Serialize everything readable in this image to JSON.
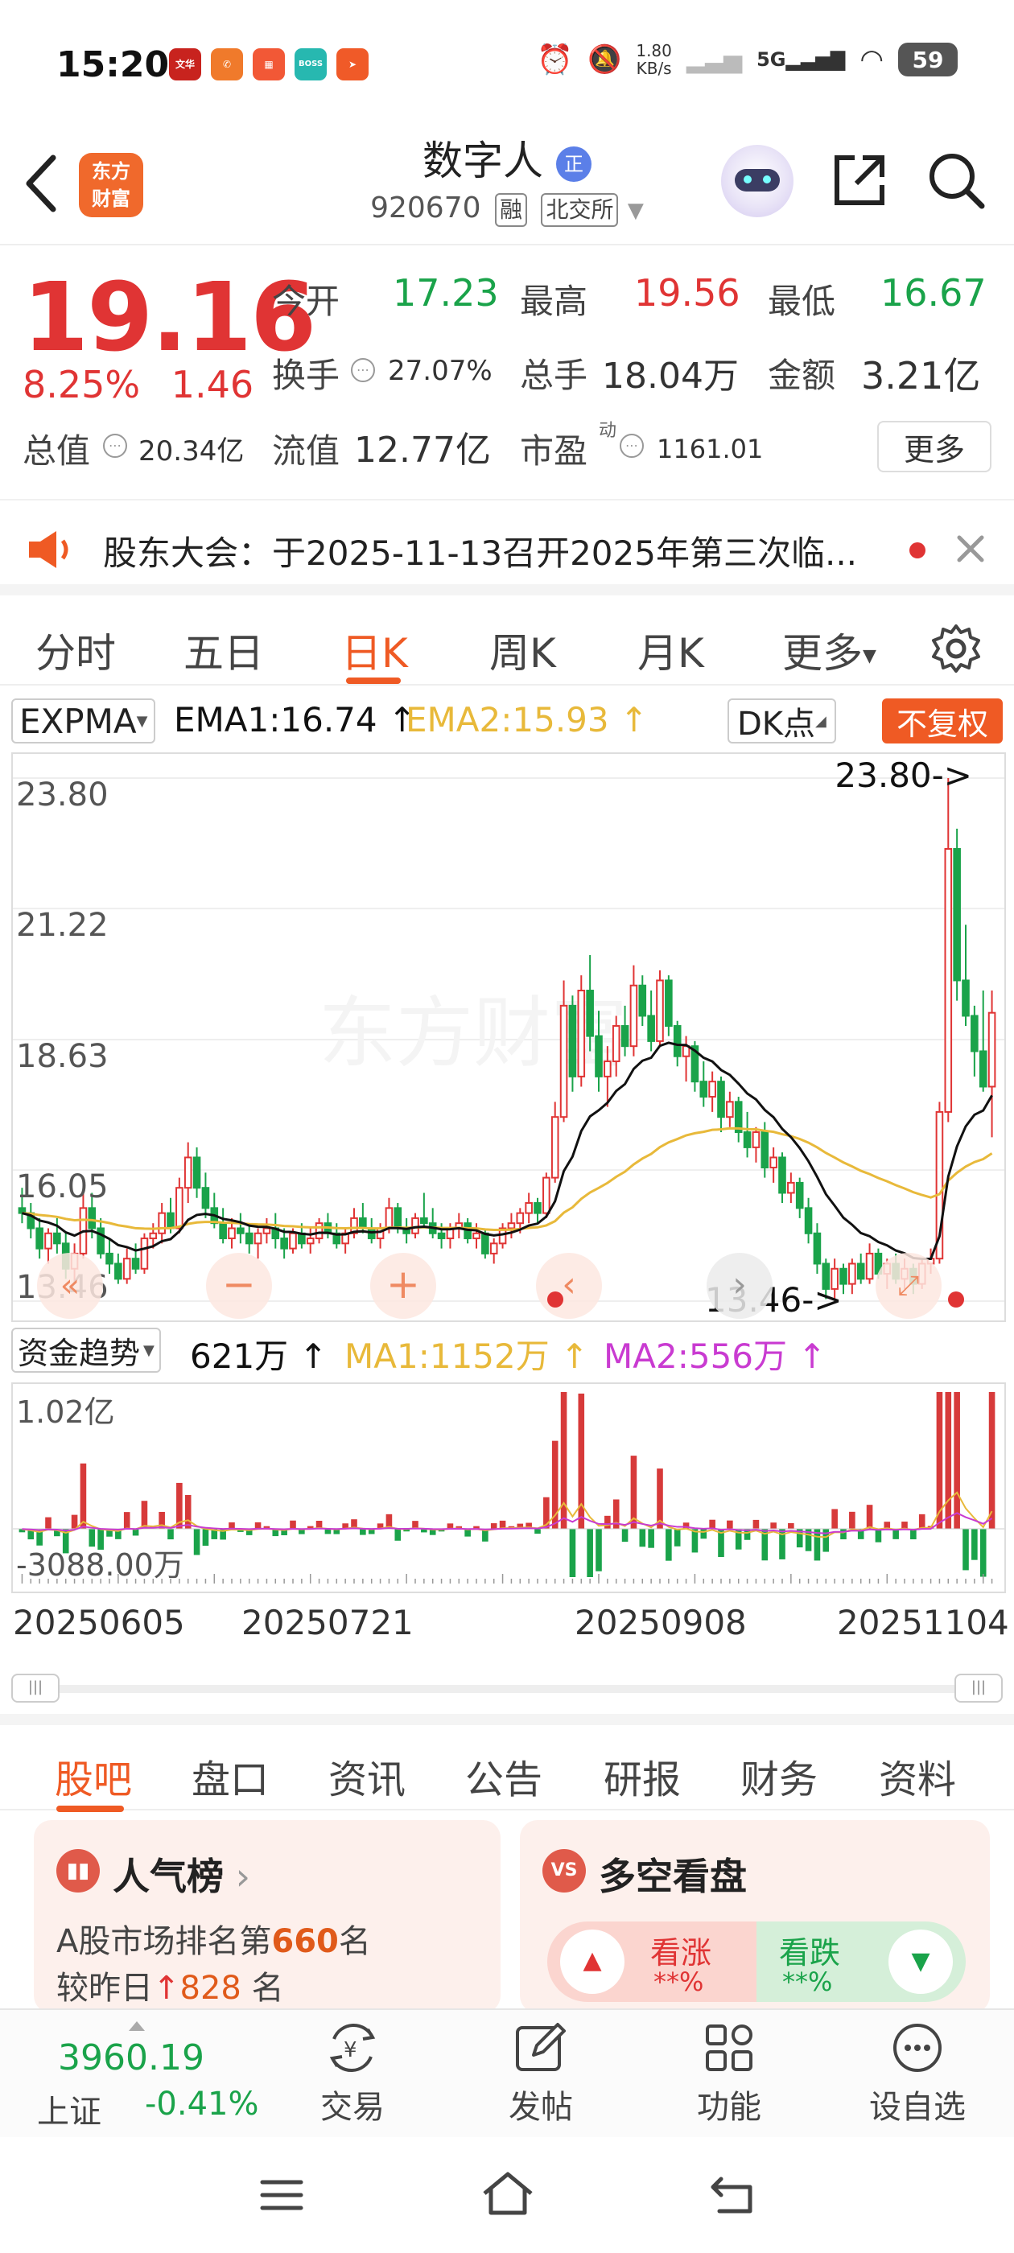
{
  "status": {
    "time": "15:20",
    "apps": [
      {
        "icon": "wenhua-app-icon",
        "text": "文华",
        "color": "#c8231e"
      },
      {
        "icon": "phone-app-icon",
        "text": "✆",
        "color": "#f07a2b"
      },
      {
        "icon": "app-icon-3",
        "text": "▦",
        "color": "#f25836"
      },
      {
        "icon": "boss-zhipin-icon",
        "text": "BOSS",
        "color": "#27b8b0"
      },
      {
        "icon": "send-app-icon",
        "text": "➤",
        "color": "#f05a28"
      }
    ],
    "net_speed": "1.80\nKB/s",
    "signal": "5G",
    "battery": "59"
  },
  "header": {
    "logo_line1": "东方",
    "logo_line2": "财富",
    "stock_name": "数字人",
    "stock_code": "920670",
    "tag_margin": "融",
    "tag_exchange": "北交所"
  },
  "quote": {
    "price": "19.16",
    "change_pct": "8.25%",
    "change": "1.46",
    "open_label": "今开",
    "open": "17.23",
    "high_label": "最高",
    "high": "19.56",
    "low_label": "最低",
    "low": "16.67",
    "turnover_label": "换手",
    "turnover": "27.07%",
    "volume_label": "总手",
    "volume": "18.04万",
    "amount_label": "金额",
    "amount": "3.21亿",
    "mktcap_label": "总值",
    "mktcap": "20.34亿",
    "float_label": "流值",
    "float": "12.77亿",
    "pe_label": "市盈",
    "pe_sup": "动",
    "pe": "1161.01",
    "more": "更多"
  },
  "notice": {
    "text": "股东大会：于2025-11-13召开2025年第三次临..."
  },
  "kline_tabs": [
    "分时",
    "五日",
    "日K",
    "周K",
    "月K",
    "更多"
  ],
  "active_kline_tab": 2,
  "indicator": {
    "name": "EXPMA",
    "ema1": "EMA1:16.74 ↑",
    "ema2": "EMA2:15.93 ↑",
    "dk": "DK点",
    "adjust": "不复权"
  },
  "chart_labels": {
    "y_ticks": [
      "23.80",
      "21.22",
      "18.63",
      "16.05",
      "13.46"
    ],
    "max_marker": "23.80->",
    "min_marker": "13.46->",
    "watermark": "东方财富"
  },
  "chart_data": [
    {
      "type": "candlestick",
      "ylim": [
        13.46,
        23.8
      ],
      "y_ticks": [
        23.8,
        21.22,
        18.63,
        16.05,
        13.46
      ],
      "x_ticks": [
        "20250605",
        "20250721",
        "20250908",
        "20251104"
      ],
      "max": 23.8,
      "min": 13.46,
      "series": [
        {
          "name": "EMA1",
          "last": 16.74,
          "color": "#111111"
        },
        {
          "name": "EMA2",
          "last": 15.93,
          "color": "#e8b93a"
        }
      ],
      "ohlc": [
        [
          15.3,
          15.7,
          15.0,
          15.2
        ],
        [
          15.2,
          15.4,
          14.7,
          14.9
        ],
        [
          14.9,
          15.1,
          14.3,
          14.5
        ],
        [
          14.5,
          14.9,
          14.2,
          14.8
        ],
        [
          14.8,
          15.1,
          14.4,
          14.6
        ],
        [
          14.6,
          14.8,
          13.9,
          14.1
        ],
        [
          14.1,
          14.6,
          13.8,
          14.4
        ],
        [
          14.4,
          15.6,
          14.3,
          15.3
        ],
        [
          15.3,
          15.6,
          14.7,
          14.9
        ],
        [
          14.9,
          15.1,
          14.3,
          14.4
        ],
        [
          14.4,
          14.7,
          14.0,
          14.2
        ],
        [
          14.2,
          14.4,
          13.8,
          13.9
        ],
        [
          13.9,
          14.5,
          13.8,
          14.3
        ],
        [
          14.3,
          14.6,
          14.0,
          14.1
        ],
        [
          14.1,
          14.8,
          14.0,
          14.7
        ],
        [
          14.7,
          15.0,
          14.5,
          14.8
        ],
        [
          14.8,
          15.4,
          14.6,
          15.2
        ],
        [
          15.2,
          15.5,
          14.8,
          14.9
        ],
        [
          14.9,
          15.9,
          14.8,
          15.7
        ],
        [
          15.7,
          16.6,
          15.4,
          16.3
        ],
        [
          16.3,
          16.5,
          15.5,
          15.7
        ],
        [
          15.7,
          16.0,
          15.1,
          15.3
        ],
        [
          15.3,
          15.6,
          14.9,
          15.0
        ],
        [
          15.0,
          15.3,
          14.6,
          14.7
        ],
        [
          14.7,
          15.1,
          14.5,
          14.9
        ],
        [
          14.9,
          15.2,
          14.6,
          14.8
        ],
        [
          14.8,
          15.0,
          14.4,
          14.6
        ],
        [
          14.6,
          14.9,
          14.3,
          14.8
        ],
        [
          14.8,
          15.1,
          14.6,
          14.9
        ],
        [
          14.9,
          15.2,
          14.5,
          14.7
        ],
        [
          14.7,
          14.9,
          14.3,
          14.5
        ],
        [
          14.5,
          14.9,
          14.4,
          14.8
        ],
        [
          14.8,
          15.0,
          14.5,
          14.6
        ],
        [
          14.6,
          14.9,
          14.4,
          14.7
        ],
        [
          14.7,
          15.1,
          14.6,
          15.0
        ],
        [
          15.0,
          15.2,
          14.7,
          14.8
        ],
        [
          14.8,
          15.0,
          14.5,
          14.6
        ],
        [
          14.6,
          14.9,
          14.4,
          14.8
        ],
        [
          14.8,
          15.3,
          14.7,
          15.1
        ],
        [
          15.1,
          15.4,
          14.8,
          14.9
        ],
        [
          14.9,
          15.1,
          14.6,
          14.7
        ],
        [
          14.7,
          15.0,
          14.5,
          14.9
        ],
        [
          14.9,
          15.5,
          14.8,
          15.3
        ],
        [
          15.3,
          15.4,
          14.8,
          14.9
        ],
        [
          14.9,
          15.1,
          14.6,
          14.8
        ],
        [
          14.8,
          15.2,
          14.7,
          15.1
        ],
        [
          15.1,
          15.6,
          14.9,
          15.0
        ],
        [
          15.0,
          15.3,
          14.7,
          14.8
        ],
        [
          14.8,
          15.0,
          14.5,
          14.7
        ],
        [
          14.7,
          15.0,
          14.5,
          14.9
        ],
        [
          14.9,
          15.2,
          14.7,
          15.0
        ],
        [
          15.0,
          15.1,
          14.6,
          14.7
        ],
        [
          14.7,
          15.0,
          14.5,
          14.8
        ],
        [
          14.8,
          14.9,
          14.3,
          14.4
        ],
        [
          14.4,
          14.7,
          14.2,
          14.6
        ],
        [
          14.6,
          15.0,
          14.5,
          14.9
        ],
        [
          14.9,
          15.2,
          14.7,
          15.0
        ],
        [
          15.0,
          15.3,
          14.8,
          15.2
        ],
        [
          15.2,
          15.6,
          15.0,
          15.4
        ],
        [
          15.4,
          15.5,
          15.0,
          15.2
        ],
        [
          15.2,
          16.0,
          15.1,
          15.9
        ],
        [
          15.9,
          17.4,
          15.8,
          17.1
        ],
        [
          17.1,
          19.8,
          17.0,
          19.3
        ],
        [
          19.3,
          19.5,
          17.6,
          17.9
        ],
        [
          17.9,
          19.9,
          17.7,
          19.6
        ],
        [
          19.6,
          20.3,
          18.4,
          18.7
        ],
        [
          18.7,
          19.2,
          17.6,
          17.9
        ],
        [
          17.9,
          18.5,
          17.3,
          18.2
        ],
        [
          18.2,
          19.1,
          17.9,
          18.9
        ],
        [
          18.9,
          19.3,
          18.3,
          18.5
        ],
        [
          18.5,
          20.1,
          18.3,
          19.7
        ],
        [
          19.7,
          19.9,
          18.9,
          19.1
        ],
        [
          19.1,
          19.6,
          18.4,
          18.6
        ],
        [
          18.6,
          20.0,
          18.5,
          19.8
        ],
        [
          19.8,
          19.9,
          18.7,
          18.9
        ],
        [
          18.9,
          19.0,
          18.1,
          18.3
        ],
        [
          18.3,
          18.7,
          17.8,
          18.5
        ],
        [
          18.5,
          18.6,
          17.6,
          17.8
        ],
        [
          17.8,
          18.2,
          17.3,
          17.5
        ],
        [
          17.5,
          18.0,
          17.2,
          17.8
        ],
        [
          17.8,
          17.9,
          16.8,
          17.1
        ],
        [
          17.1,
          17.6,
          16.9,
          17.4
        ],
        [
          17.4,
          17.5,
          16.6,
          16.8
        ],
        [
          16.8,
          17.2,
          16.3,
          16.5
        ],
        [
          16.5,
          16.9,
          16.2,
          16.8
        ],
        [
          16.8,
          17.0,
          15.9,
          16.1
        ],
        [
          16.1,
          16.5,
          15.8,
          16.3
        ],
        [
          16.3,
          16.4,
          15.4,
          15.6
        ],
        [
          15.6,
          16.0,
          15.4,
          15.8
        ],
        [
          15.8,
          15.9,
          15.1,
          15.3
        ],
        [
          15.3,
          15.5,
          14.6,
          14.8
        ],
        [
          14.8,
          15.0,
          14.0,
          14.2
        ],
        [
          14.2,
          14.3,
          13.5,
          13.7
        ],
        [
          13.7,
          14.3,
          13.5,
          14.1
        ],
        [
          14.1,
          14.2,
          13.6,
          13.8
        ],
        [
          13.8,
          14.3,
          13.6,
          14.2
        ],
        [
          14.2,
          14.4,
          13.8,
          13.9
        ],
        [
          13.9,
          14.6,
          13.8,
          14.4
        ],
        [
          14.4,
          14.5,
          13.9,
          14.0
        ],
        [
          14.0,
          14.3,
          13.7,
          14.2
        ],
        [
          14.2,
          14.4,
          13.8,
          13.9
        ],
        [
          13.9,
          14.3,
          13.7,
          14.1
        ],
        [
          14.1,
          14.2,
          13.6,
          13.8
        ],
        [
          13.8,
          14.3,
          13.7,
          14.2
        ],
        [
          14.2,
          14.5,
          14.0,
          14.3
        ],
        [
          14.3,
          17.4,
          14.2,
          17.2
        ],
        [
          17.2,
          23.8,
          17.0,
          22.4
        ],
        [
          22.4,
          22.8,
          19.4,
          19.8
        ],
        [
          19.8,
          20.9,
          18.9,
          19.1
        ],
        [
          19.1,
          19.3,
          17.9,
          18.4
        ],
        [
          18.4,
          19.6,
          17.6,
          17.7
        ],
        [
          17.7,
          19.6,
          16.7,
          19.16
        ]
      ]
    },
    {
      "type": "bar",
      "title": "资金趋势",
      "value_label": "621万 ↑",
      "ylim": [
        -3088.0,
        10200
      ],
      "y_ticks": [
        "1.02亿",
        "-3088.00万"
      ],
      "series": [
        {
          "name": "MA1",
          "last": "1152万 ↑",
          "color": "#e8b93a"
        },
        {
          "name": "MA2",
          "last": "556万 ↑",
          "color": "#c93bd1"
        }
      ]
    }
  ],
  "vol_header": {
    "title": "资金趋势",
    "value": "621万 ↑",
    "ma1": "MA1:1152万 ↑",
    "ma2": "MA2:556万 ↑",
    "y_top": "1.02亿",
    "y_bottom": "-3088.00万"
  },
  "dates": [
    "20250605",
    "20250721",
    "20250908",
    "20251104"
  ],
  "bottom_tabs": [
    "股吧",
    "盘口",
    "资讯",
    "公告",
    "研报",
    "财务",
    "资料"
  ],
  "cards": {
    "popularity_title": "人气榜",
    "popularity_line1_pre": "A股市场排名第",
    "popularity_rank": "660",
    "popularity_line1_post": "名",
    "popularity_line2_pre": "较昨日",
    "popularity_change": "828",
    "popularity_line2_post": "名",
    "bullbear_title": "多空看盘",
    "bull_label": "看涨",
    "bull_value": "**%",
    "bear_label": "看跌",
    "bear_value": "**%"
  },
  "bottom_bar": {
    "index_value": "3960.19",
    "index_name": "上证",
    "index_change": "-0.41%",
    "trade": "交易",
    "post": "发帖",
    "functions": "功能",
    "watchlist": "设自选"
  }
}
